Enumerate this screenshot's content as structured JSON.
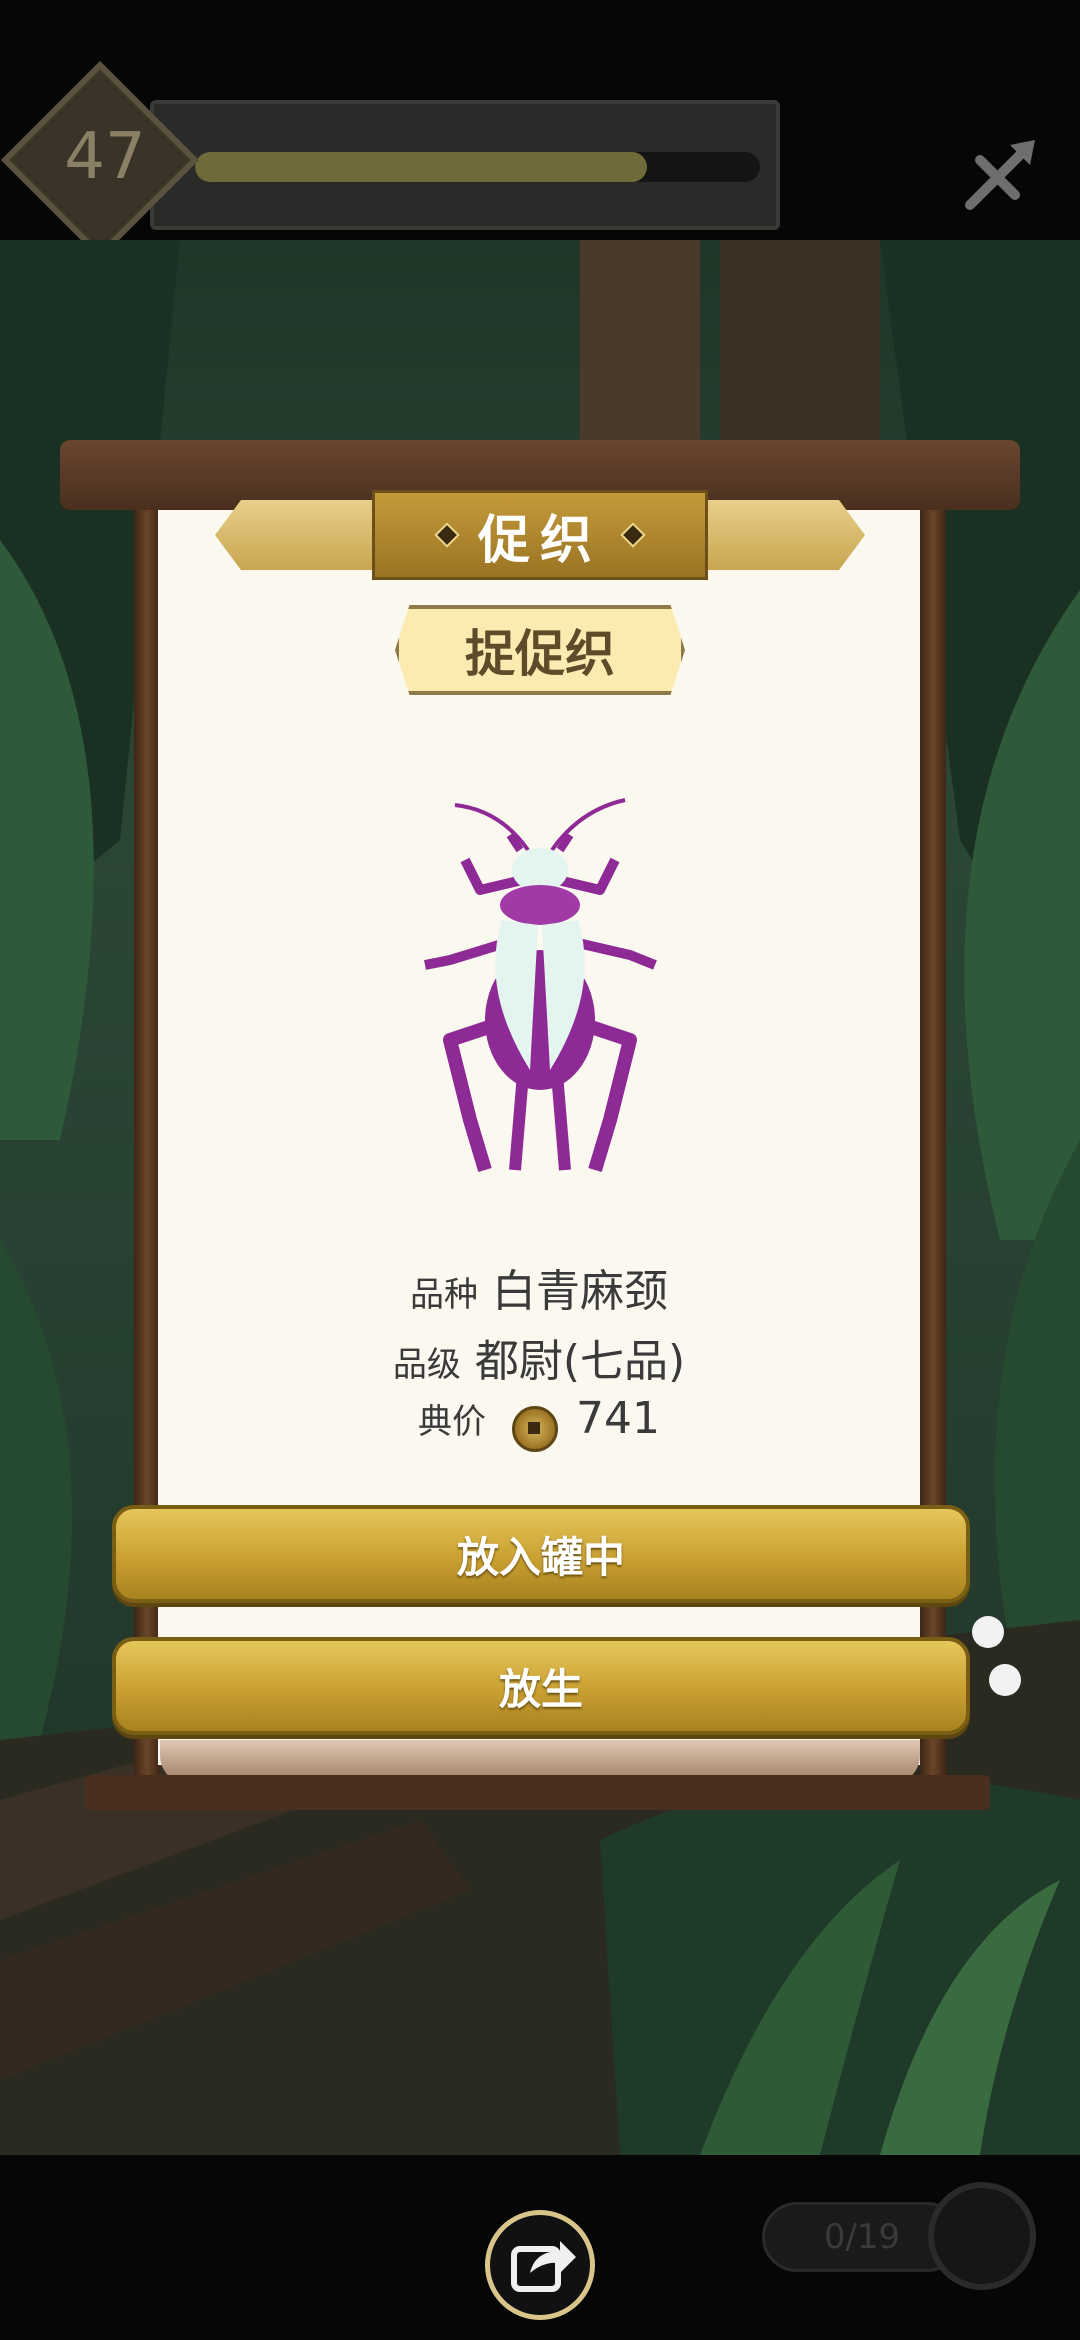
{
  "hud": {
    "level": "47",
    "progress": 0.8
  },
  "panel": {
    "title": "促织",
    "subtitle": "捉促织",
    "breed_label": "品种",
    "breed_value": "白青麻颈",
    "rank_label": "品级",
    "rank_value": "都尉(七品)",
    "price_label": "典价",
    "price_value": "741"
  },
  "actions": {
    "put_in_jar": "放入罐中",
    "release": "放生"
  },
  "footer": {
    "counter": "0/19"
  },
  "colors": {
    "cricket_body": "#8e2a96",
    "cricket_wings": "#e4f4ef",
    "gold": "#c9a032"
  }
}
